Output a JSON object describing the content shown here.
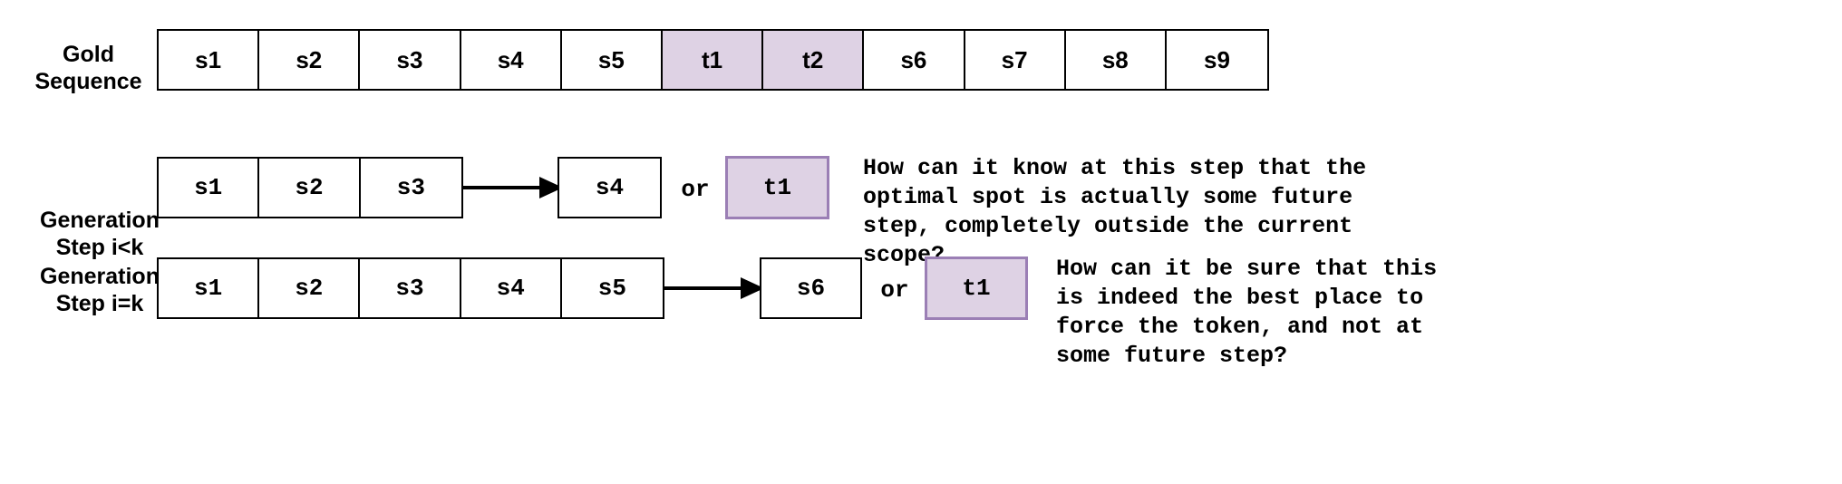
{
  "figure": {
    "title_alt": "Gold sequence and generation step comparison diagram",
    "colors": {
      "token_fill": "#ded2e4",
      "token_border": "#9b7fb5",
      "box_border": "#000000",
      "text": "#000000",
      "background": "#ffffff"
    }
  },
  "gold_row": {
    "label": "Gold\nSequence",
    "cells": [
      {
        "text": "s1",
        "highlight": false
      },
      {
        "text": "s2",
        "highlight": false
      },
      {
        "text": "s3",
        "highlight": false
      },
      {
        "text": "s4",
        "highlight": false
      },
      {
        "text": "s5",
        "highlight": false
      },
      {
        "text": "t1",
        "highlight": true
      },
      {
        "text": "t2",
        "highlight": true
      },
      {
        "text": "s6",
        "highlight": false
      },
      {
        "text": "s7",
        "highlight": false
      },
      {
        "text": "s8",
        "highlight": false
      },
      {
        "text": "s9",
        "highlight": false
      }
    ]
  },
  "gen_rows": [
    {
      "label": "Generation\nStep i<k",
      "context": [
        "s1",
        "s2",
        "s3"
      ],
      "arrow": "right-arrow",
      "option_a": "s4",
      "or_text": "or",
      "option_b": "t1",
      "question": "How can it know at this step that the\noptimal spot is actually some future\nstep, completely outside the current scope?"
    },
    {
      "label": "Generation\nStep i=k",
      "context": [
        "s1",
        "s2",
        "s3",
        "s4",
        "s5"
      ],
      "arrow": "right-arrow",
      "option_a": "s6",
      "or_text": "or",
      "option_b": "t1",
      "question": "How can it be sure that this\nis indeed the best place to\nforce the token, and not at\nsome future step?"
    }
  ]
}
